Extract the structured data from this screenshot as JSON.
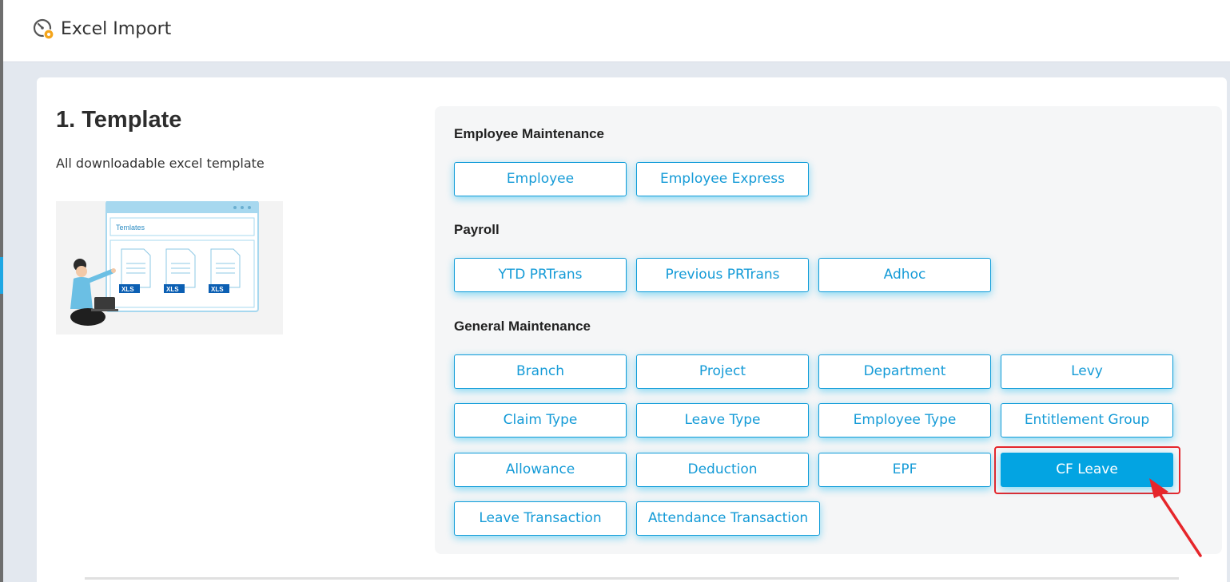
{
  "app": {
    "title": "Excel Import",
    "icon": "gauge-settings-icon"
  },
  "template_section": {
    "heading": "1. Template",
    "subtitle": "All downloadable excel template",
    "illustration": {
      "window_label": "Temlates",
      "file_badge": "XLS"
    }
  },
  "groups": [
    {
      "title": "Employee Maintenance",
      "buttons": [
        "Employee",
        "Employee Express"
      ]
    },
    {
      "title": "Payroll",
      "buttons": [
        "YTD PRTrans",
        "Previous PRTrans",
        "Adhoc"
      ]
    },
    {
      "title": "General Maintenance",
      "buttons": [
        "Branch",
        "Project",
        "Department",
        "Levy",
        "Claim Type",
        "Leave Type",
        "Employee Type",
        "Entitlement Group",
        "Allowance",
        "Deduction",
        "EPF",
        "CF Leave",
        "Leave Transaction",
        "Attendance Transaction"
      ]
    }
  ],
  "selected_button": "CF Leave",
  "colors": {
    "accent": "#03a4e2",
    "highlight": "#e6262b",
    "button_text": "#159bd7"
  }
}
